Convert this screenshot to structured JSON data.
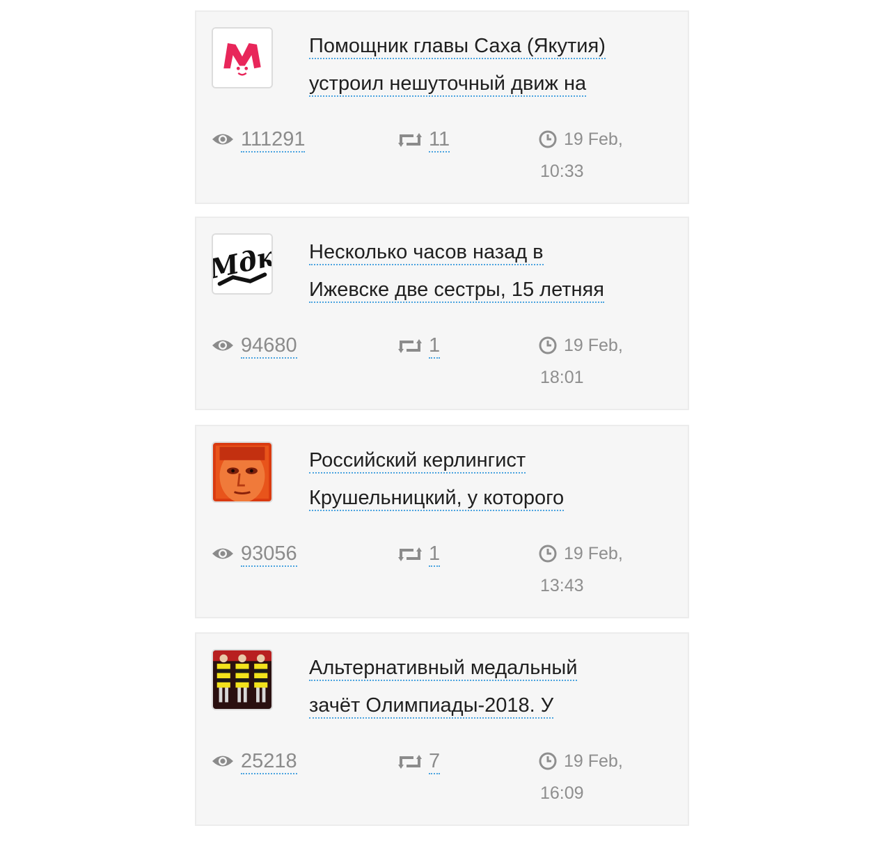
{
  "posts": [
    {
      "avatar": "mash-logo-icon",
      "title_lines": [
        "Помощник главы Саха (Якутия)",
        "устроил нешуточный движ на"
      ],
      "views": "111291",
      "shares": "11",
      "date": "19 Feb,",
      "time": "10:33"
    },
    {
      "avatar": "mdk-logo-icon",
      "title_lines": [
        "Несколько часов назад в",
        "Ижевске две сестры, 15 летняя"
      ],
      "views": "94680",
      "shares": "1",
      "date": "19 Feb,",
      "time": "18:01"
    },
    {
      "avatar": "face-photo-icon",
      "title_lines": [
        "Российский керлингист",
        "Крушельницкий, у которого"
      ],
      "views": "93056",
      "shares": "1",
      "date": "19 Feb,",
      "time": "13:43"
    },
    {
      "avatar": "striped-figures-icon",
      "title_lines": [
        "Альтернативный медальный",
        "зачёт Олимпиады-2018. У"
      ],
      "views": "25218",
      "shares": "7",
      "date": "19 Feb,",
      "time": "16:09"
    }
  ],
  "icons": {
    "views": "eye-icon",
    "shares": "repost-icon",
    "date": "clock-icon"
  },
  "colors": {
    "card_background": "#f6f6f6",
    "link_underline": "#4aa3df",
    "muted_text": "#8b8b8b",
    "mash_red": "#e8265a"
  }
}
